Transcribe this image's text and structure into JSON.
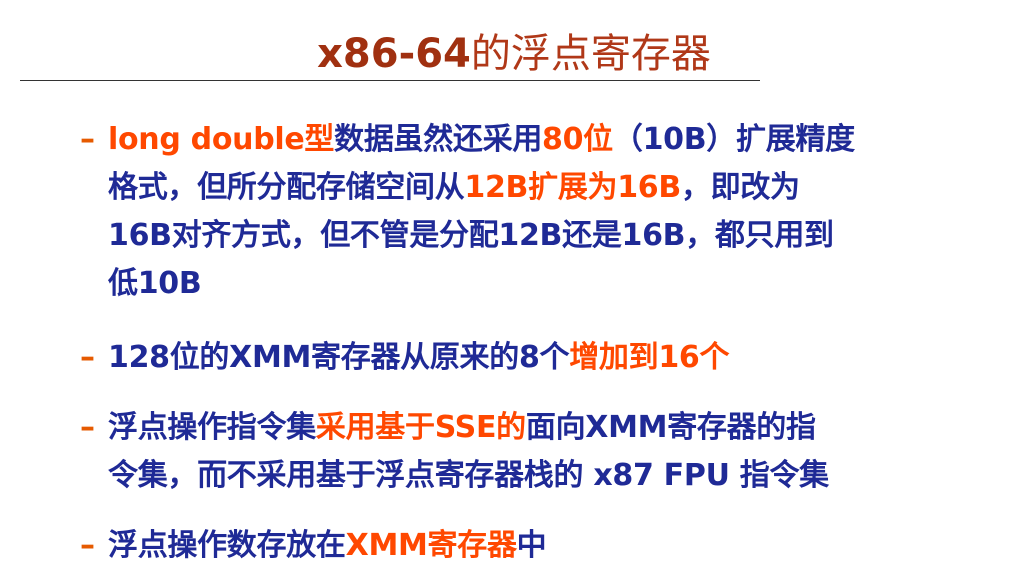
{
  "title": {
    "latin": "x86-64",
    "cjk": "的浮点寄存器"
  },
  "bullet_marker": "–",
  "bullets": [
    {
      "lines": [
        [
          {
            "text": "long double型",
            "hl": true
          },
          {
            "text": "数据虽然还采用",
            "hl": false
          },
          {
            "text": "80位",
            "hl": true
          },
          {
            "text": "（10B）扩展精度",
            "hl": false
          }
        ],
        [
          {
            "text": "格式，但所分配存储空间从",
            "hl": false
          },
          {
            "text": "12B扩展为16B",
            "hl": true
          },
          {
            "text": "，即改为",
            "hl": false
          }
        ],
        [
          {
            "text": "16B对齐方式，但不管是分配12B还是16B，都只用到",
            "hl": false
          }
        ],
        [
          {
            "text": "低10B",
            "hl": false
          }
        ]
      ]
    },
    {
      "lines": [
        [
          {
            "text": "128位的XMM寄存器从原来的8个",
            "hl": false
          },
          {
            "text": "增加到16个",
            "hl": true
          }
        ]
      ]
    },
    {
      "lines": [
        [
          {
            "text": "浮点操作指令集",
            "hl": false
          },
          {
            "text": "采用基于SSE的",
            "hl": true
          },
          {
            "text": "面向XMM寄存器的指",
            "hl": false
          }
        ],
        [
          {
            "text": "令集，而不采用基于浮点寄存器栈的 x87 FPU 指令集",
            "hl": false
          }
        ]
      ]
    },
    {
      "lines": [
        [
          {
            "text": "浮点操作数存放在",
            "hl": false
          },
          {
            "text": "XMM寄存器",
            "hl": true
          },
          {
            "text": "中",
            "hl": false
          }
        ]
      ]
    }
  ],
  "colors": {
    "title": "#b03818",
    "body": "#1f2a96",
    "highlight": "#ff4800",
    "marker": "#e65a00"
  }
}
